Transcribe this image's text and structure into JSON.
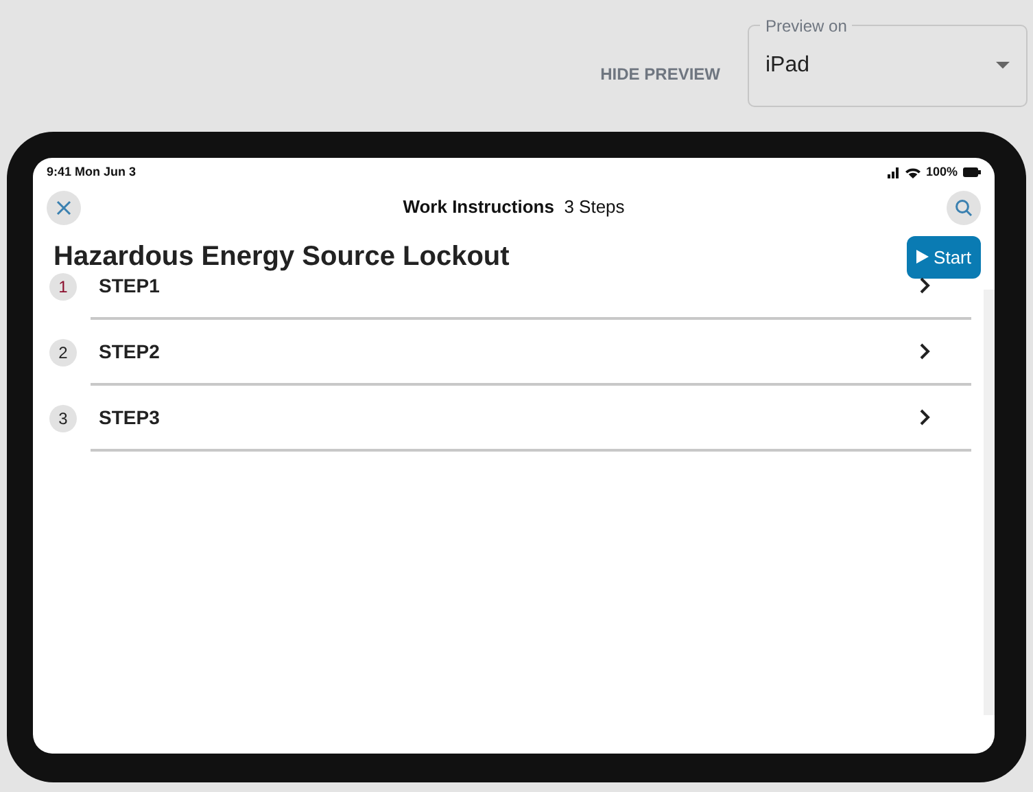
{
  "toolbar": {
    "hide_preview": "HIDE PREVIEW",
    "preview_on": {
      "label": "Preview on",
      "value": "iPad"
    }
  },
  "device": {
    "status_bar": {
      "time": "9:41 Mon Jun 3",
      "battery": "100%"
    },
    "header": {
      "title": "Work Instructions",
      "count": "3 Steps"
    },
    "heading": "Hazardous Energy Source Lockout",
    "start_button": "Start",
    "steps": [
      {
        "number": "1",
        "label": "STEP1",
        "current": true
      },
      {
        "number": "2",
        "label": "STEP2",
        "current": false
      },
      {
        "number": "3",
        "label": "STEP3",
        "current": false
      }
    ]
  }
}
